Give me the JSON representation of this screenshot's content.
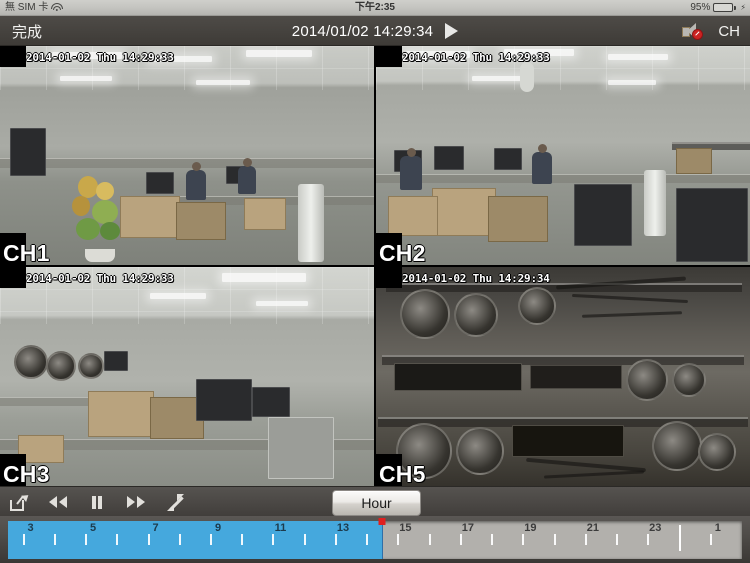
{
  "status_bar": {
    "carrier": "無 SIM 卡",
    "wifi_icon": "wifi-icon",
    "time": "下午2:35",
    "battery_percent": "95%",
    "battery_level": 95,
    "charging_glyph": "⚡"
  },
  "nav_bar": {
    "done_label": "完成",
    "datetime": "2014/01/02 14:29:34",
    "play_icon": "play-icon",
    "mute_icon": "speaker-mute-icon",
    "channel_label": "CH"
  },
  "video_grid": {
    "panes": [
      {
        "channel": "CH1",
        "timestamp": "2014-01-02 Thu 14:29:33",
        "scene": "office-a"
      },
      {
        "channel": "CH2",
        "timestamp": "2014-01-02 Thu 14:29:33",
        "scene": "office-b"
      },
      {
        "channel": "CH3",
        "timestamp": "2014-01-02 Thu 14:29:33",
        "scene": "office-c"
      },
      {
        "channel": "CH5",
        "timestamp": "2014-01-02 Thu 14:29:34",
        "scene": "rack"
      }
    ]
  },
  "control_bar": {
    "share_icon": "share-export-icon",
    "rewind_icon": "rewind-icon",
    "pause_icon": "pause-icon",
    "forward_icon": "fast-forward-icon",
    "fullscreen_icon": "expand-fullscreen-icon",
    "scale_label": "Hour"
  },
  "timeline": {
    "start_hour": 2.5,
    "end_hour": 26.0,
    "recorded_until_hour": 14.49,
    "playhead_hour": 14.49,
    "recorded_color": "#45a8dd",
    "empty_color": "#b2b0ac",
    "playhead_color": "#e02020",
    "day_boundary_hour": 24,
    "hour_labels": [
      "3",
      "5",
      "7",
      "9",
      "11",
      "13",
      "15",
      "17",
      "19",
      "21",
      "23",
      "1"
    ],
    "hour_label_values": [
      3,
      5,
      7,
      9,
      11,
      13,
      15,
      17,
      19,
      21,
      23,
      25
    ],
    "tick_hours": [
      3,
      4,
      5,
      6,
      7,
      8,
      9,
      10,
      11,
      12,
      13,
      14,
      15,
      16,
      17,
      18,
      19,
      20,
      21,
      22,
      23,
      24,
      25,
      26
    ]
  }
}
